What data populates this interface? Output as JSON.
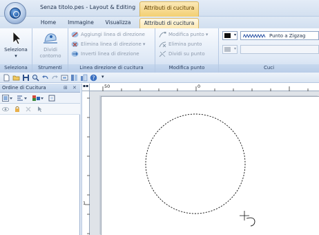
{
  "window": {
    "title": "Senza titolo.pes - Layout & Editing",
    "context_tab": "Attributi di cucitura"
  },
  "tabs": [
    {
      "label": "Home",
      "active": false
    },
    {
      "label": "Immagine",
      "active": false
    },
    {
      "label": "Visualizza",
      "active": false
    },
    {
      "label": "Attributi di cucitura",
      "active": true
    }
  ],
  "ribbon": {
    "seleziona_group": {
      "button_label": "Seleziona",
      "dropdown_arrow": "▾",
      "group_label": "Seleziona"
    },
    "strumenti_group": {
      "button_line1": "Dividi",
      "button_line2": "contorno",
      "group_label": "Strumenti"
    },
    "linea_direzione_group": {
      "add": "Aggiungi linea di direzione",
      "remove": "Elimina linea di direzione",
      "remove_arrow": "▾",
      "invert": "Inverti linea di direzione",
      "group_label": "Linea direzione di cucitura"
    },
    "modifica_punto_group": {
      "modify": "Modifica punto",
      "modify_arrow": "▾",
      "delete": "Elimina punto",
      "split": "Dividi su punto",
      "group_label": "Modifica punto"
    },
    "cuci_group": {
      "stitch_type": "Punto a Zigzag",
      "dropdown_arrow": "▾",
      "group_label": "Cuci"
    }
  },
  "quick_access": {
    "customize_arrow": "▾"
  },
  "panel": {
    "title": "Ordine di Cucitura",
    "pin": "⊞",
    "close": "✕"
  },
  "rulers": {
    "h_labels": [
      "50",
      "0"
    ],
    "v_labels": [
      "1"
    ]
  },
  "colors": {
    "accent_orange": "#f3cf71",
    "ribbon_blue": "#dfe9f6",
    "canvas_grey": "#dfe3e8"
  }
}
